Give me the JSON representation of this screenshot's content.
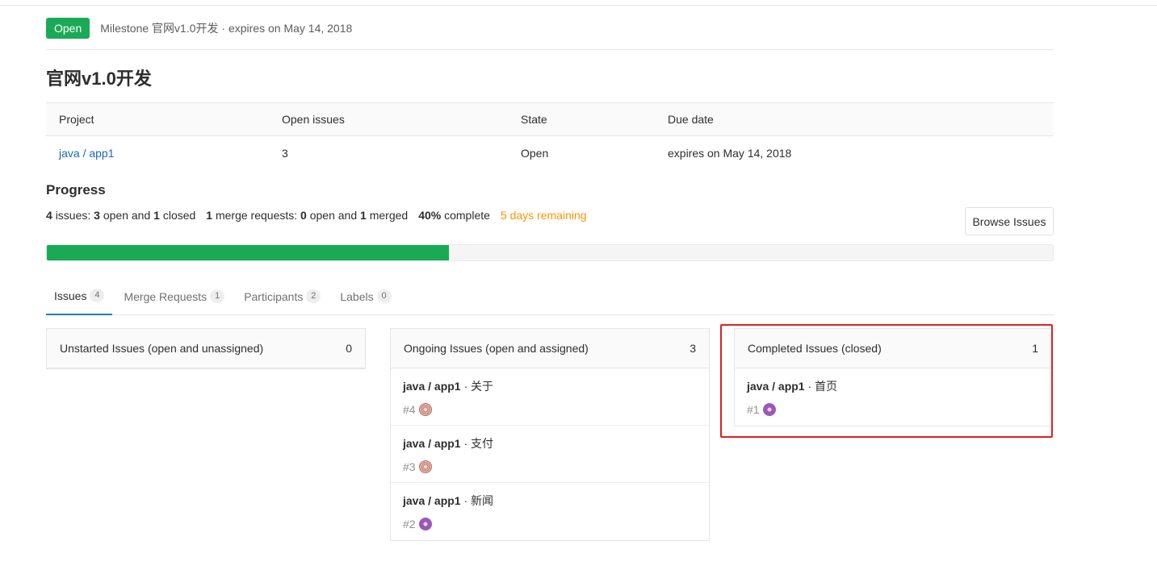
{
  "header": {
    "status": "Open",
    "text": "Milestone 官网v1.0开发 · expires on May 14, 2018"
  },
  "title": "官网v1.0开发",
  "info_table": {
    "headers": [
      "Project",
      "Open issues",
      "State",
      "Due date"
    ],
    "row": {
      "project": "java / app1",
      "open_issues": "3",
      "state": "Open",
      "due_date": "expires on May 14, 2018"
    }
  },
  "progress": {
    "title": "Progress",
    "issues_total": "4",
    "issues_word": "issues:",
    "issues_open": "3",
    "open_and": "open and",
    "issues_closed": "1",
    "closed_word": "closed",
    "mr_total": "1",
    "mr_word": "merge requests:",
    "mr_open": "0",
    "mr_open_and": "open and",
    "mr_merged": "1",
    "merged_word": "merged",
    "percent_text": "40%",
    "complete_word": "complete",
    "remaining": "5 days remaining",
    "fill_fraction": 0.4,
    "fill_color": "#1aaa55"
  },
  "browse_button": "Browse Issues",
  "tabs": [
    {
      "label": "Issues",
      "count": "4"
    },
    {
      "label": "Merge Requests",
      "count": "1"
    },
    {
      "label": "Participants",
      "count": "2"
    },
    {
      "label": "Labels",
      "count": "0"
    }
  ],
  "panels": {
    "unstarted": {
      "title": "Unstarted Issues (open and unassigned)",
      "count": "0",
      "issues": []
    },
    "ongoing": {
      "title": "Ongoing Issues (open and assigned)",
      "count": "3",
      "issues": [
        {
          "project": "java / app1",
          "sep": " · ",
          "name": "关于",
          "number": "#4",
          "avatar": "brown"
        },
        {
          "project": "java / app1",
          "sep": " · ",
          "name": "支付",
          "number": "#3",
          "avatar": "brown"
        },
        {
          "project": "java / app1",
          "sep": " · ",
          "name": "新闻",
          "number": "#2",
          "avatar": "purple"
        }
      ]
    },
    "completed": {
      "title": "Completed Issues (closed)",
      "count": "1",
      "issues": [
        {
          "project": "java / app1",
          "sep": " · ",
          "name": "首页",
          "number": "#1",
          "avatar": "purple"
        }
      ]
    }
  },
  "colors": {
    "accent": "#1aaa55",
    "link": "#1b69b6",
    "warning": "#fc9403",
    "highlight": "#e02020"
  }
}
